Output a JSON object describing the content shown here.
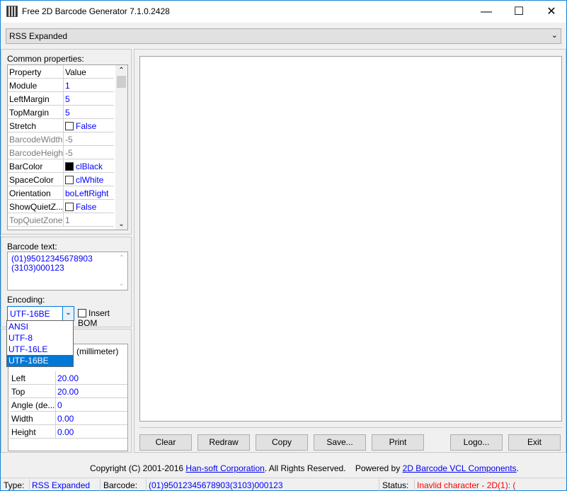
{
  "window": {
    "title": "Free 2D Barcode Generator 7.1.0.2428"
  },
  "symbology": {
    "selected": "RSS Expanded"
  },
  "common": {
    "label": "Common properties:",
    "headers": [
      "Property",
      "Value"
    ],
    "rows": [
      {
        "p": "Module",
        "v": "1",
        "style": "blue"
      },
      {
        "p": "LeftMargin",
        "v": "5",
        "style": "blue"
      },
      {
        "p": "TopMargin",
        "v": "5",
        "style": "blue"
      },
      {
        "p": "Stretch",
        "v": "False",
        "style": "blue",
        "check": "empty"
      },
      {
        "p": "BarcodeWidth",
        "v": "-5",
        "style": "gray"
      },
      {
        "p": "BarcodeHeight",
        "v": "-5",
        "style": "gray"
      },
      {
        "p": "BarColor",
        "v": "clBlack",
        "style": "blue",
        "check": "black"
      },
      {
        "p": "SpaceColor",
        "v": "clWhite",
        "style": "blue",
        "check": "empty"
      },
      {
        "p": "Orientation",
        "v": "boLeftRight",
        "style": "blue"
      },
      {
        "p": "ShowQuietZ...",
        "v": "False",
        "style": "blue",
        "check": "empty"
      },
      {
        "p": "TopQuietZone",
        "v": "1",
        "style": "gray"
      }
    ]
  },
  "barcode_text": {
    "label": "Barcode text:",
    "lines": [
      "(01)95012345678903",
      "(3103)000123"
    ]
  },
  "encoding": {
    "label": "Encoding:",
    "selected": "UTF-16BE",
    "options": [
      "ANSI",
      "UTF-8",
      "UTF-16LE",
      "UTF-16BE"
    ],
    "insert_bom": "Insert BOM"
  },
  "position": {
    "header_value": "(millimeter)",
    "rows": [
      {
        "p": "Left",
        "v": "20.00"
      },
      {
        "p": "Top",
        "v": "20.00"
      },
      {
        "p": "Angle (de...",
        "v": "0"
      },
      {
        "p": "Width",
        "v": "0.00"
      },
      {
        "p": "Height",
        "v": "0.00"
      }
    ]
  },
  "buttons": [
    "Clear",
    "Redraw",
    "Copy",
    "Save...",
    "Print",
    "Logo...",
    "Exit"
  ],
  "footer": {
    "copyright": "Copyright (C) 2001-2016 ",
    "company": "Han-soft Corporation",
    "rights": ". All Rights Reserved.",
    "powered": "Powered by ",
    "components": "2D Barcode VCL Components",
    "dot": "."
  },
  "statusbar": {
    "type_label": "Type:",
    "type_value": "RSS Expanded",
    "barcode_label": "Barcode:",
    "barcode_value": "(01)95012345678903(3103)000123",
    "status_label": "Status:",
    "status_value": "Inavlid character - 2D(1): (",
    "status_color": "#ff0000"
  }
}
